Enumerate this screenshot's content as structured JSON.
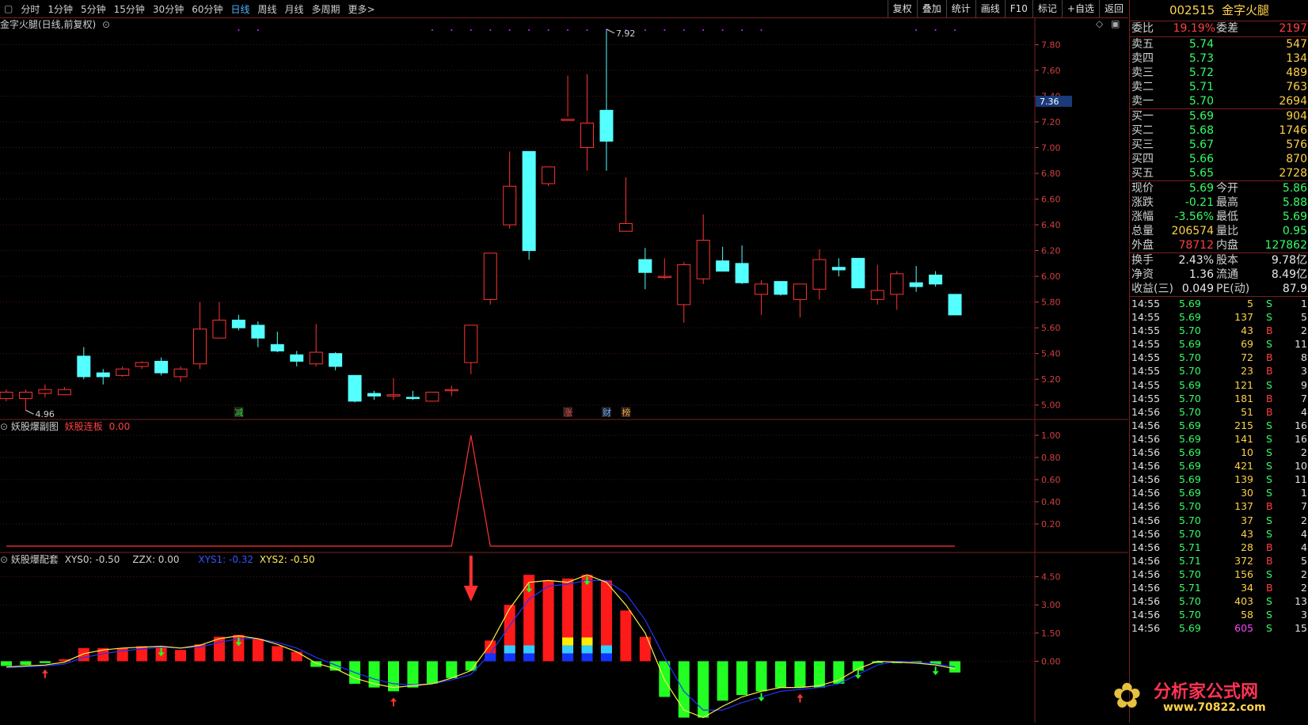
{
  "toolbar": {
    "menu_icon": "menu-icon",
    "periods": [
      "分时",
      "1分钟",
      "5分钟",
      "15分钟",
      "30分钟",
      "60分钟",
      "日线",
      "周线",
      "月线",
      "多周期",
      "更多>"
    ],
    "active_period": "日线",
    "right_buttons": [
      "复权",
      "叠加",
      "统计",
      "画线",
      "F10",
      "标记",
      "+自选",
      "返回"
    ]
  },
  "main_panel": {
    "title": "金字火腿(日线,前复权)",
    "price_label": "7.36",
    "high_label": "7.92",
    "low_label": "4.96",
    "yticks": [
      "7.80",
      "7.60",
      "7.40",
      "7.20",
      "7.00",
      "6.80",
      "6.60",
      "6.40",
      "6.20",
      "6.00",
      "5.80",
      "5.60",
      "5.40",
      "5.20",
      "5.00"
    ],
    "markers": [
      {
        "text": "减",
        "color": "#33dd33"
      },
      {
        "text": "涨",
        "color": "#ff4444"
      },
      {
        "text": "财",
        "color": "#6fa8ff"
      },
      {
        "text": "榜",
        "color": "#ff9933"
      }
    ]
  },
  "sub1": {
    "name": "妖股爆副图",
    "label": "妖股连板",
    "value": "0.00",
    "yticks": [
      "1.00",
      "0.80",
      "0.60",
      "0.40",
      "0.20"
    ]
  },
  "sub2": {
    "name": "妖股爆配套",
    "xys0": "XYS0: -0.50",
    "zzx": "ZZX: 0.00",
    "xys1": "XYS1: -0.32",
    "xys2": "XYS2: -0.50",
    "yticks": [
      "4.50",
      "3.00",
      "1.50",
      "0.00"
    ]
  },
  "colors": {
    "up": "#ff3333",
    "down": "#54ffff",
    "grid": "#7a1f1f",
    "axis_text": "#d04040"
  },
  "chart_data": {
    "type": "candlestick",
    "ylim": [
      4.9,
      7.95
    ],
    "candles": [
      {
        "o": 5.05,
        "c": 5.1,
        "h": 5.12,
        "l": 5.03
      },
      {
        "o": 5.05,
        "c": 5.1,
        "h": 5.12,
        "l": 4.96
      },
      {
        "o": 5.09,
        "c": 5.12,
        "h": 5.16,
        "l": 5.06
      },
      {
        "o": 5.08,
        "c": 5.12,
        "h": 5.14,
        "l": 5.08
      },
      {
        "o": 5.38,
        "c": 5.22,
        "h": 5.45,
        "l": 5.2
      },
      {
        "o": 5.25,
        "c": 5.22,
        "h": 5.28,
        "l": 5.16
      },
      {
        "o": 5.23,
        "c": 5.28,
        "h": 5.3,
        "l": 5.22
      },
      {
        "o": 5.3,
        "c": 5.33,
        "h": 5.34,
        "l": 5.28
      },
      {
        "o": 5.34,
        "c": 5.25,
        "h": 5.37,
        "l": 5.23
      },
      {
        "o": 5.22,
        "c": 5.28,
        "h": 5.3,
        "l": 5.18
      },
      {
        "o": 5.32,
        "c": 5.59,
        "h": 5.8,
        "l": 5.28
      },
      {
        "o": 5.52,
        "c": 5.66,
        "h": 5.8,
        "l": 5.52
      },
      {
        "o": 5.66,
        "c": 5.6,
        "h": 5.7,
        "l": 5.58
      },
      {
        "o": 5.62,
        "c": 5.52,
        "h": 5.65,
        "l": 5.45
      },
      {
        "o": 5.47,
        "c": 5.42,
        "h": 5.57,
        "l": 5.41
      },
      {
        "o": 5.39,
        "c": 5.34,
        "h": 5.42,
        "l": 5.3
      },
      {
        "o": 5.32,
        "c": 5.41,
        "h": 5.63,
        "l": 5.3
      },
      {
        "o": 5.4,
        "c": 5.3,
        "h": 5.41,
        "l": 5.27
      },
      {
        "o": 5.23,
        "c": 5.03,
        "h": 5.23,
        "l": 5.02
      },
      {
        "o": 5.09,
        "c": 5.07,
        "h": 5.11,
        "l": 5.04
      },
      {
        "o": 5.07,
        "c": 5.08,
        "h": 5.21,
        "l": 5.04
      },
      {
        "o": 5.06,
        "c": 5.05,
        "h": 5.11,
        "l": 5.04
      },
      {
        "o": 5.03,
        "c": 5.1,
        "h": 5.1,
        "l": 5.03
      },
      {
        "o": 5.12,
        "c": 5.12,
        "h": 5.15,
        "l": 5.07
      },
      {
        "o": 5.33,
        "c": 5.62,
        "h": 5.62,
        "l": 5.24
      },
      {
        "o": 5.82,
        "c": 6.18,
        "h": 6.18,
        "l": 5.78
      },
      {
        "o": 6.4,
        "c": 6.7,
        "h": 6.97,
        "l": 6.37
      },
      {
        "o": 6.97,
        "c": 6.2,
        "h": 6.97,
        "l": 6.13
      },
      {
        "o": 6.72,
        "c": 6.85,
        "h": 6.85,
        "l": 6.7
      },
      {
        "o": 7.22,
        "c": 7.22,
        "h": 7.56,
        "l": 7.24
      },
      {
        "o": 7.0,
        "c": 7.19,
        "h": 7.57,
        "l": 6.82
      },
      {
        "o": 7.29,
        "c": 7.05,
        "h": 7.92,
        "l": 6.82
      },
      {
        "o": 6.35,
        "c": 6.41,
        "h": 6.77,
        "l": 6.35
      },
      {
        "o": 6.13,
        "c": 6.03,
        "h": 6.22,
        "l": 5.9
      },
      {
        "o": 6.0,
        "c": 6.0,
        "h": 6.14,
        "l": 5.98
      },
      {
        "o": 5.78,
        "c": 6.09,
        "h": 6.11,
        "l": 5.64
      },
      {
        "o": 5.98,
        "c": 6.28,
        "h": 6.48,
        "l": 5.94
      },
      {
        "o": 6.12,
        "c": 6.04,
        "h": 6.23,
        "l": 6.04
      },
      {
        "o": 6.1,
        "c": 5.95,
        "h": 6.24,
        "l": 5.94
      },
      {
        "o": 5.86,
        "c": 5.94,
        "h": 5.97,
        "l": 5.7
      },
      {
        "o": 5.96,
        "c": 5.86,
        "h": 5.96,
        "l": 5.85
      },
      {
        "o": 5.82,
        "c": 5.94,
        "h": 5.94,
        "l": 5.68
      },
      {
        "o": 5.9,
        "c": 6.13,
        "h": 6.21,
        "l": 5.82
      },
      {
        "o": 6.07,
        "c": 6.05,
        "h": 6.14,
        "l": 6.0
      },
      {
        "o": 6.14,
        "c": 5.91,
        "h": 6.14,
        "l": 5.91
      },
      {
        "o": 5.82,
        "c": 5.89,
        "h": 6.09,
        "l": 5.78
      },
      {
        "o": 5.86,
        "c": 6.02,
        "h": 6.04,
        "l": 5.74
      },
      {
        "o": 5.95,
        "c": 5.92,
        "h": 6.08,
        "l": 5.88
      },
      {
        "o": 6.01,
        "c": 5.94,
        "h": 6.04,
        "l": 5.92
      },
      {
        "o": 5.86,
        "c": 5.7,
        "h": 5.86,
        "l": 5.7
      }
    ],
    "indicator1": {
      "spike_index": 24,
      "spike_value": 1.0
    },
    "indicator2": {
      "ylim": [
        -3.1,
        5.2
      ],
      "bars": [
        -0.25,
        -0.2,
        -0.1,
        0.1,
        0.7,
        0.7,
        0.7,
        0.8,
        0.8,
        0.6,
        0.9,
        1.3,
        1.4,
        1.2,
        0.8,
        0.5,
        -0.3,
        -0.5,
        -1.2,
        -1.4,
        -1.6,
        -1.4,
        -1.2,
        -0.9,
        -0.5,
        1.1,
        3.0,
        4.6,
        4.3,
        4.4,
        4.6,
        4.3,
        2.7,
        1.3,
        -1.9,
        -3.0,
        -3.0,
        -2.1,
        -1.8,
        -1.6,
        -1.4,
        -1.4,
        -1.4,
        -1.2,
        -0.5,
        -0.1,
        -0.1,
        -0.1,
        -0.2,
        -0.6
      ],
      "line1": [
        -0.3,
        -0.25,
        -0.2,
        -0.05,
        0.4,
        0.6,
        0.7,
        0.75,
        0.8,
        0.7,
        0.85,
        1.2,
        1.35,
        1.2,
        0.9,
        0.5,
        -0.1,
        -0.4,
        -0.9,
        -1.2,
        -1.4,
        -1.3,
        -1.2,
        -0.9,
        -0.5,
        0.9,
        2.8,
        4.2,
        4.3,
        4.2,
        4.6,
        4.2,
        3.0,
        1.5,
        -1.0,
        -2.6,
        -3.0,
        -2.4,
        -1.9,
        -1.6,
        -1.4,
        -1.4,
        -1.3,
        -1.0,
        -0.4,
        0.0,
        -0.05,
        -0.1,
        -0.2,
        -0.4
      ],
      "line2": [
        -0.35,
        -0.3,
        -0.25,
        -0.15,
        0.2,
        0.4,
        0.55,
        0.65,
        0.75,
        0.7,
        0.75,
        1.0,
        1.2,
        1.2,
        1.0,
        0.7,
        0.2,
        -0.2,
        -0.6,
        -0.95,
        -1.2,
        -1.25,
        -1.2,
        -1.0,
        -0.7,
        0.4,
        1.9,
        3.3,
        4.0,
        4.1,
        4.3,
        4.3,
        3.6,
        2.2,
        0.2,
        -1.6,
        -2.6,
        -2.6,
        -2.2,
        -1.9,
        -1.6,
        -1.5,
        -1.4,
        -1.2,
        -0.7,
        -0.2,
        0.0,
        -0.05,
        -0.15,
        -0.3
      ],
      "up_arrows": [
        2,
        20,
        36,
        41
      ],
      "down_arrows": [
        8,
        12,
        27,
        30,
        39,
        44,
        48
      ],
      "big_arrow_index": 24
    }
  },
  "quote": {
    "code": "002515",
    "name": "金字火腿",
    "weibi_label": "委比",
    "weibi": "19.19%",
    "weicha_label": "委差",
    "weicha": "2197",
    "sells": [
      {
        "label": "卖五",
        "price": "5.74",
        "vol": "547"
      },
      {
        "label": "卖四",
        "price": "5.73",
        "vol": "134"
      },
      {
        "label": "卖三",
        "price": "5.72",
        "vol": "489"
      },
      {
        "label": "卖二",
        "price": "5.71",
        "vol": "763"
      },
      {
        "label": "卖一",
        "price": "5.70",
        "vol": "2694"
      }
    ],
    "buys": [
      {
        "label": "买一",
        "price": "5.69",
        "vol": "904"
      },
      {
        "label": "买二",
        "price": "5.68",
        "vol": "1746"
      },
      {
        "label": "买三",
        "price": "5.67",
        "vol": "576"
      },
      {
        "label": "买四",
        "price": "5.66",
        "vol": "870"
      },
      {
        "label": "买五",
        "price": "5.65",
        "vol": "2728"
      }
    ],
    "stats1": [
      {
        "l1": "现价",
        "v1": "5.69",
        "c1": "#33ff66",
        "l2": "今开",
        "v2": "5.86",
        "c2": "#33ff66"
      },
      {
        "l1": "涨跌",
        "v1": "-0.21",
        "c1": "#33ff66",
        "l2": "最高",
        "v2": "5.88",
        "c2": "#33ff66"
      },
      {
        "l1": "涨幅",
        "v1": "-3.56%",
        "c1": "#33ff66",
        "l2": "最低",
        "v2": "5.69",
        "c2": "#33ff66"
      },
      {
        "l1": "总量",
        "v1": "206574",
        "c1": "#ffd24a",
        "l2": "量比",
        "v2": "0.95",
        "c2": "#33ff66"
      },
      {
        "l1": "外盘",
        "v1": "78712",
        "c1": "#ff4040",
        "l2": "内盘",
        "v2": "127862",
        "c2": "#33ff66"
      }
    ],
    "stats2": [
      {
        "l1": "换手",
        "v1": "2.43%",
        "l2": "股本",
        "v2": "9.78亿"
      },
      {
        "l1": "净资",
        "v1": "1.36",
        "l2": "流通",
        "v2": "8.49亿"
      },
      {
        "l1": "收益(三)",
        "v1": "0.049",
        "l2": "PE(动)",
        "v2": "87.9"
      }
    ],
    "ticks": [
      {
        "t": "14:55",
        "p": "5.69",
        "v": "5",
        "s": "S",
        "n": "1"
      },
      {
        "t": "14:55",
        "p": "5.69",
        "v": "137",
        "s": "S",
        "n": "5"
      },
      {
        "t": "14:55",
        "p": "5.70",
        "v": "43",
        "s": "B",
        "n": "2"
      },
      {
        "t": "14:55",
        "p": "5.69",
        "v": "69",
        "s": "S",
        "n": "11"
      },
      {
        "t": "14:55",
        "p": "5.70",
        "v": "72",
        "s": "B",
        "n": "8"
      },
      {
        "t": "14:55",
        "p": "5.70",
        "v": "23",
        "s": "B",
        "n": "3"
      },
      {
        "t": "14:55",
        "p": "5.69",
        "v": "121",
        "s": "S",
        "n": "9"
      },
      {
        "t": "14:55",
        "p": "5.70",
        "v": "181",
        "s": "B",
        "n": "7"
      },
      {
        "t": "14:56",
        "p": "5.70",
        "v": "51",
        "s": "B",
        "n": "4"
      },
      {
        "t": "14:56",
        "p": "5.69",
        "v": "215",
        "s": "S",
        "n": "16"
      },
      {
        "t": "14:56",
        "p": "5.69",
        "v": "141",
        "s": "S",
        "n": "16"
      },
      {
        "t": "14:56",
        "p": "5.69",
        "v": "10",
        "s": "S",
        "n": "2"
      },
      {
        "t": "14:56",
        "p": "5.69",
        "v": "421",
        "s": "S",
        "n": "10"
      },
      {
        "t": "14:56",
        "p": "5.69",
        "v": "139",
        "s": "S",
        "n": "11"
      },
      {
        "t": "14:56",
        "p": "5.69",
        "v": "30",
        "s": "S",
        "n": "1"
      },
      {
        "t": "14:56",
        "p": "5.70",
        "v": "137",
        "s": "B",
        "n": "7"
      },
      {
        "t": "14:56",
        "p": "5.70",
        "v": "37",
        "s": "S",
        "n": "2"
      },
      {
        "t": "14:56",
        "p": "5.70",
        "v": "43",
        "s": "S",
        "n": "4"
      },
      {
        "t": "14:56",
        "p": "5.71",
        "v": "28",
        "s": "B",
        "n": "4"
      },
      {
        "t": "14:56",
        "p": "5.71",
        "v": "372",
        "s": "B",
        "n": "5"
      },
      {
        "t": "14:56",
        "p": "5.70",
        "v": "156",
        "s": "S",
        "n": "2"
      },
      {
        "t": "14:56",
        "p": "5.71",
        "v": "34",
        "s": "B",
        "n": "2"
      },
      {
        "t": "14:56",
        "p": "5.70",
        "v": "403",
        "s": "S",
        "n": "13"
      },
      {
        "t": "14:56",
        "p": "5.70",
        "v": "58",
        "s": "S",
        "n": "3"
      },
      {
        "t": "14:56",
        "p": "5.69",
        "v": "605",
        "s": "S",
        "n": "15"
      }
    ]
  },
  "watermark": {
    "name": "分析家公式网",
    "url": "www.70822.com"
  }
}
